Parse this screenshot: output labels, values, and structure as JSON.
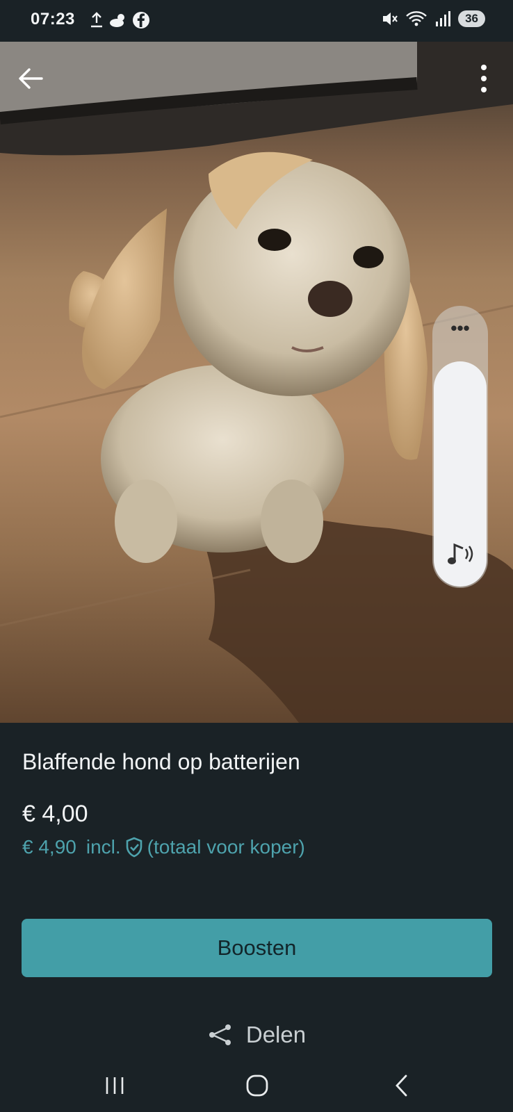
{
  "status_bar": {
    "time": "07:23",
    "left_icons": [
      "upload-icon",
      "weather-icon",
      "facebook-icon"
    ],
    "right_icons": [
      "mute-icon",
      "wifi-icon",
      "signal-icon"
    ],
    "battery": "36"
  },
  "photo": {
    "subject_icon": "plush-dog-image",
    "back_icon": "back-arrow-icon",
    "more_icon": "more-vertical-icon"
  },
  "volume_panel": {
    "menu_icon": "more-horizontal-icon",
    "level": 0.96,
    "stream_icon": "music-note-icon"
  },
  "listing": {
    "title": "Blaffende hond op batterijen",
    "price": "€ 4,00",
    "price_incl_amount": "€ 4,90",
    "price_incl_label": "incl.",
    "price_incl_icon": "shield-check-icon",
    "price_incl_note": "(totaal voor koper)"
  },
  "actions": {
    "boost_label": "Boosten",
    "share_label": "Delen",
    "share_icon": "share-icon"
  },
  "nav_bar": {
    "icons": [
      "recent-apps-icon",
      "home-icon",
      "back-icon"
    ]
  },
  "colors": {
    "background": "#1a2226",
    "accent": "#439ea7",
    "accent_text": "#4ea3ad"
  }
}
